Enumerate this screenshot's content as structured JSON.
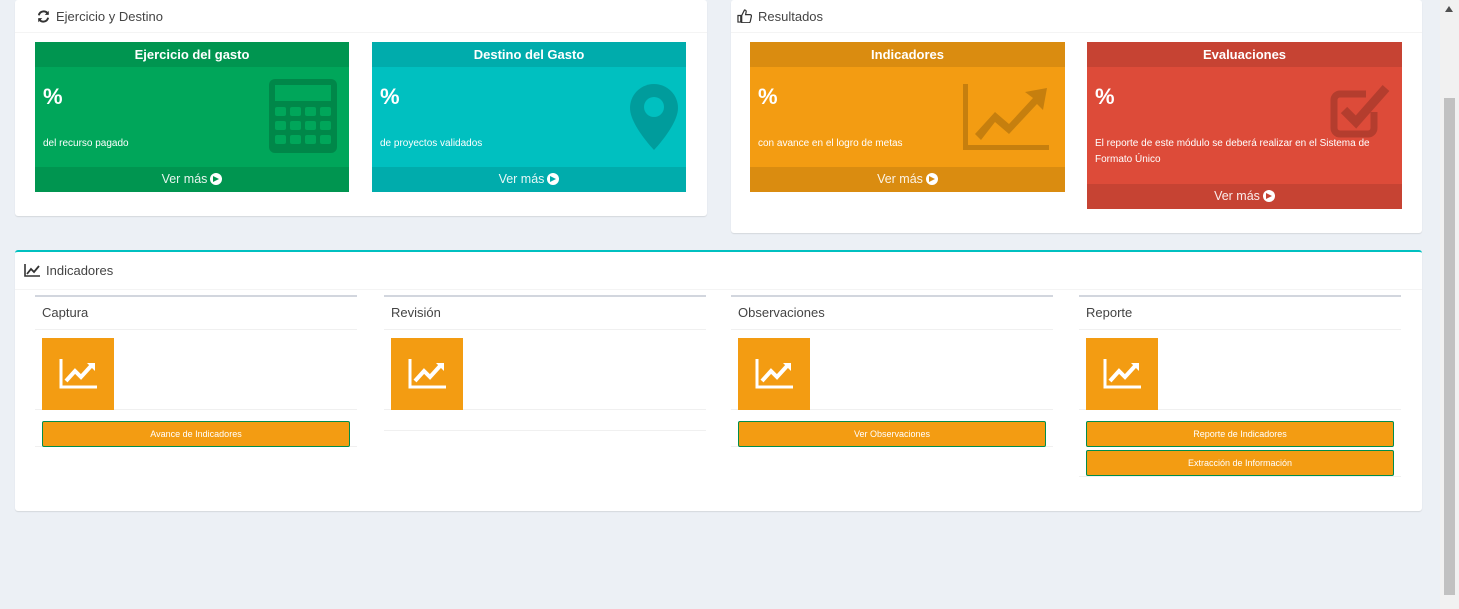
{
  "ejercicio_panel": {
    "title": "Ejercicio y Destino",
    "boxes": [
      {
        "title": "Ejercicio del gasto",
        "value": "%",
        "desc": "del recurso pagado",
        "link": "Ver más",
        "color": "#00a65a"
      },
      {
        "title": "Destino del Gasto",
        "value": "%",
        "desc": "de proyectos validados",
        "link": "Ver más",
        "color": "#00c0c0"
      }
    ]
  },
  "resultados_panel": {
    "title": "Resultados",
    "boxes": [
      {
        "title": "Indicadores",
        "value": "%",
        "desc": "con avance en el logro de metas",
        "link": "Ver más",
        "color": "#f39c12"
      },
      {
        "title": "Evaluaciones",
        "value": "%",
        "desc": "El reporte de este módulo se deberá realizar en el Sistema de Formato Único",
        "link": "Ver más",
        "color": "#dd4b39"
      }
    ]
  },
  "indicadores_panel": {
    "title": "Indicadores",
    "columns": [
      {
        "title": "Captura",
        "buttons": [
          "Avance de Indicadores"
        ]
      },
      {
        "title": "Revisión",
        "buttons": []
      },
      {
        "title": "Observaciones",
        "buttons": [
          "Ver Observaciones"
        ]
      },
      {
        "title": "Reporte",
        "buttons": [
          "Reporte de Indicadores",
          "Extracción de Información"
        ]
      }
    ]
  },
  "icons": {
    "ejercicio_header": "refresh-icon",
    "resultados_header": "thumbs-up-icon",
    "indicadores_header": "line-chart-icon",
    "box_ejercicio": "calculator-icon",
    "box_destino": "map-marker-icon",
    "box_indicadores": "area-chart-icon",
    "box_evaluaciones": "check-square-icon",
    "columns": "line-chart-icon"
  },
  "colors": {
    "accent": "#00c0c0",
    "button_border": "#008d4c",
    "background": "#ecf0f5"
  }
}
